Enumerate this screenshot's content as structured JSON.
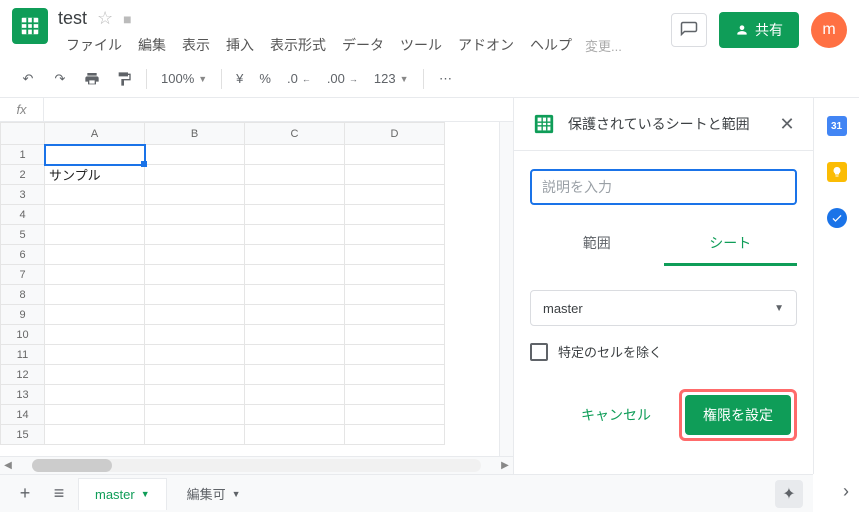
{
  "header": {
    "doc_title": "test",
    "avatar_letter": "m",
    "share_label": "共有",
    "menus": [
      "ファイル",
      "編集",
      "表示",
      "挿入",
      "表示形式",
      "データ",
      "ツール",
      "アドオン",
      "ヘルプ"
    ],
    "change_text": "変更..."
  },
  "toolbar": {
    "zoom": "100%",
    "currency": "¥",
    "percent": "%",
    "dec_dec": ".0",
    "dec_inc": ".00",
    "format": "123"
  },
  "columns": [
    "A",
    "B",
    "C",
    "D"
  ],
  "rows": [
    1,
    2,
    3,
    4,
    5,
    6,
    7,
    8,
    9,
    10,
    11,
    12,
    13,
    14,
    15
  ],
  "cells": {
    "A2": "サンプル"
  },
  "sidepanel": {
    "title": "保護されているシートと範囲",
    "placeholder": "説明を入力",
    "tab_range": "範囲",
    "tab_sheet": "シート",
    "select_value": "master",
    "exclude_label": "特定のセルを除く",
    "cancel": "キャンセル",
    "set_perm": "権限を設定"
  },
  "rail": {
    "cal": "31"
  },
  "tabs": {
    "active": "master",
    "other": "編集可"
  }
}
